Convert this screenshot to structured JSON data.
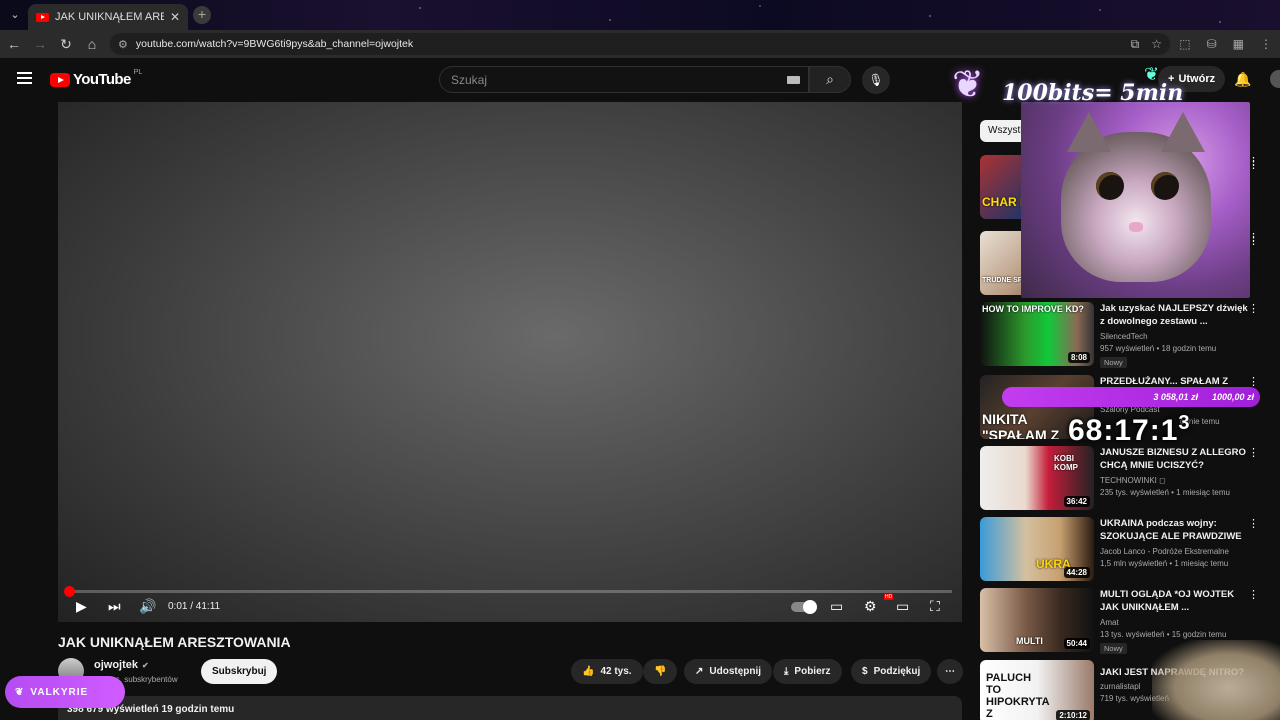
{
  "browser": {
    "tab_title": "JAK UNIKNĄŁEM ARESZTOWA",
    "url": "youtube.com/watch?v=9BWG6ti9pys&ab_channel=ojwojtek"
  },
  "header": {
    "logo_text": "YouTube",
    "logo_country": "PL",
    "search_placeholder": "Szukaj",
    "create_label": "Utwórz"
  },
  "overlay": {
    "bits_text": "100bits= 5min",
    "timer_amount_1": "3 058,01 zł",
    "timer_amount_2": "1000,00 zł",
    "big_timer": "68:17:1",
    "big_timer_sup": "3",
    "valkyrie_label": "VALKYRIE"
  },
  "player": {
    "time_display": "0:01 / 41:11",
    "progress": 0.0004
  },
  "video": {
    "title": "JAK UNIKNĄŁEM ARESZTOWANIA",
    "channel": "ojwojtek",
    "subscribers": "942 tys. subskrybentów",
    "subscribe_label": "Subskrybuj",
    "likes": "42 tys.",
    "share_label": "Udostępnij",
    "download_label": "Pobierz",
    "thanks_label": "Podziękuj",
    "meta": "398 679 wyświetleń  19 godzin temu"
  },
  "sidebar": {
    "chip_label": "Wszystkie",
    "items": [
      {
        "title": "",
        "channel": "",
        "meta": "",
        "duration": "",
        "overlay": "CHAR KIR"
      },
      {
        "title": "",
        "channel": "",
        "meta": "",
        "duration": "",
        "overlay": "TRUDNE SPRAWY"
      },
      {
        "title": "Jak uzyskać NAJLEPSZY dźwięk z dowolnego zestawu ...",
        "channel": "SilencedTech",
        "meta": "957 wyświetleń • 18 godzin temu",
        "badge": "Nowy",
        "duration": "8:08",
        "overlay": "HOW TO IMPROVE KD?"
      },
      {
        "title": "PRZEDŁUŻANY... SPAŁAM Z CIOSEM",
        "channel": "Szalony Podcast",
        "meta": "odnie temu",
        "duration": "",
        "overlay": "NIKITA \"SPAŁAM Z CIO\""
      },
      {
        "title": "JANUSZE BIZNESU Z ALLEGRO CHCĄ MNIE UCISZYĆ?",
        "channel": "TECHNOWINKI ◻",
        "meta": "235 tys. wyświetleń • 1 miesiąc temu",
        "duration": "36:42",
        "overlay": "KOBI KOMP"
      },
      {
        "title": "UKRAINA podczas wojny: SZOKUJĄCE ALE PRAWDZIWE",
        "channel": "Jacob Lanco - Podróże Ekstremalne",
        "meta": "1,5 mln wyświetleń • 1 miesiąc temu",
        "duration": "44:28",
        "overlay": "UKRA"
      },
      {
        "title": "MULTI OGLĄDA *OJ WOJTEK JAK UNIKNĄŁEM ...",
        "channel": "Amat",
        "meta": "13 tys. wyświetleń • 15 godzin temu",
        "badge": "Nowy",
        "duration": "50:44",
        "overlay": "MULTI"
      },
      {
        "title": "JAKI JEST NAPRAWDĘ NITRO?",
        "channel": "zurnalistapl",
        "meta": "719 tys. wyświetleń",
        "duration": "2:10:12",
        "overlay": "PALUCH TO HIPOKRYTA Z POZNANIA"
      }
    ]
  }
}
